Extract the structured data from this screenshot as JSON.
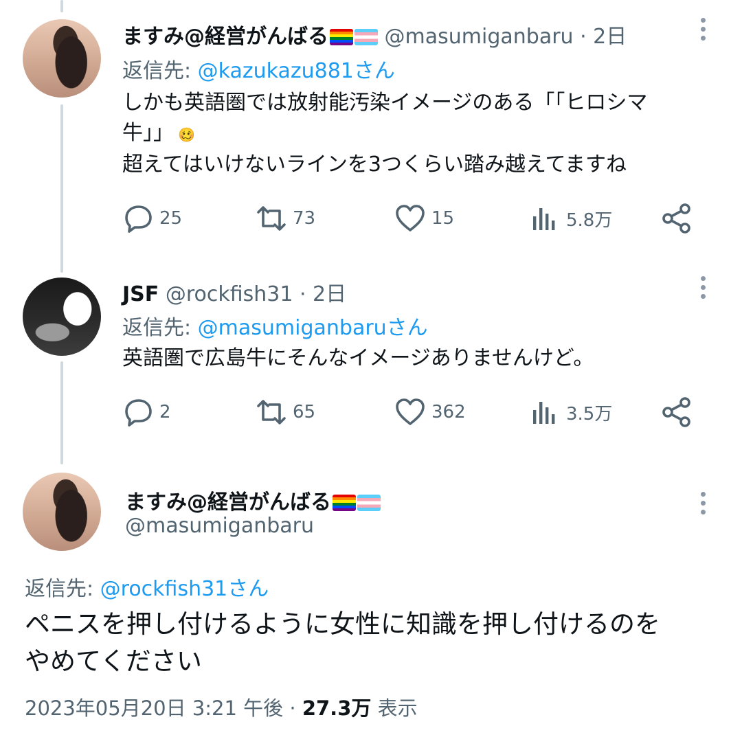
{
  "tweets": [
    {
      "display_name": "ますみ@経営がんばる",
      "handle_time": "@masumiganbaru · 2日",
      "reply_prefix": "返信先: ",
      "reply_mention": "@kazukazu881さん",
      "text_lines": [
        "しかも英語圏では放射能汚染イメージのある「「ヒロシマ",
        "牛」」",
        "超えてはいけないラインを3つくらい踏み越えてますね"
      ],
      "emoji": "🥴",
      "replies": "25",
      "retweets": "73",
      "likes": "15",
      "views": "5.8万"
    },
    {
      "display_name": "JSF",
      "handle_time": "@rockfish31 · 2日",
      "reply_prefix": "返信先: ",
      "reply_mention": "@masumiganbaruさん",
      "text_lines": [
        "英語圏で広島牛にそんなイメージありませんけど。"
      ],
      "replies": "2",
      "retweets": "65",
      "likes": "362",
      "views": "3.5万"
    }
  ],
  "main_tweet": {
    "display_name": "ますみ@経営がんばる",
    "handle": "@masumiganbaru",
    "reply_prefix": "返信先: ",
    "reply_mention": "@rockfish31さん",
    "text_lines": [
      "ペニスを押し付けるように女性に知識を押し付けるのを",
      "やめてください"
    ],
    "timestamp": "2023年05月20日 3:21 午後 · ",
    "views_count": "27.3万",
    "views_label": "表示"
  },
  "colors": {
    "text": "#0f1419",
    "secondary": "#536471",
    "link": "#1d9bf0",
    "thread_line": "#cfd9de"
  },
  "icons": [
    "reply-icon",
    "retweet-icon",
    "like-icon",
    "views-icon",
    "share-icon",
    "more-icon",
    "rainbow-flag-icon",
    "trans-flag-icon"
  ]
}
